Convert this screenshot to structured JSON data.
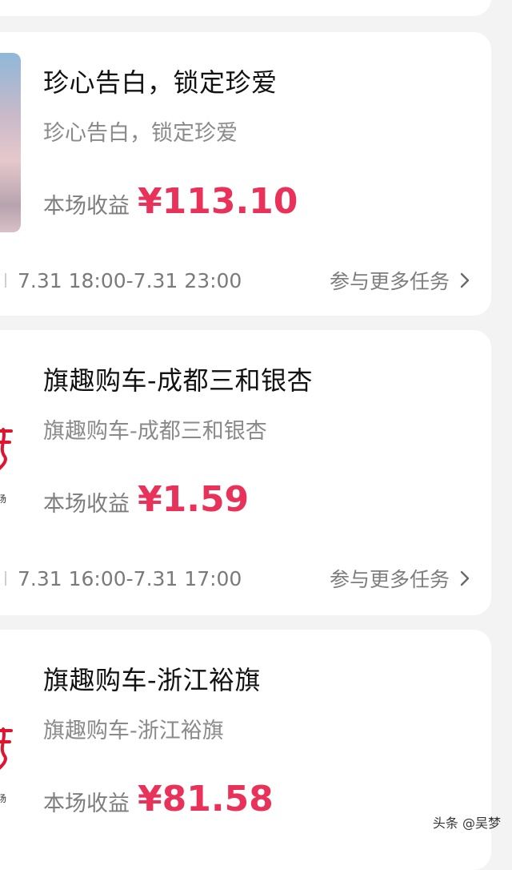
{
  "tasks": [
    {
      "title": "珍心告白，锁定珍爱",
      "subtitle": "珍心告白，锁定珍爱",
      "earnings_label": "本场收益",
      "earnings_value": "¥113.10",
      "time_range": "7.31 18:00-7.31 23:00",
      "more_label": "参与更多任务",
      "thumb_icon": "photo-thumbnail"
    },
    {
      "title": "旗趣购车-成都三和银杏",
      "subtitle": "旗趣购车-成都三和银杏",
      "earnings_label": "本场收益",
      "earnings_value": "¥1.59",
      "time_range": "7.31 16:00-7.31 17:00",
      "more_label": "参与更多任务",
      "thumb_icon": "brand-logo",
      "thumb_sub": "场"
    },
    {
      "title": "旗趣购车-浙江裕旗",
      "subtitle": "旗趣购车-浙江裕旗",
      "earnings_label": "本场收益",
      "earnings_value": "¥81.58",
      "thumb_icon": "brand-logo",
      "thumb_sub": "场"
    }
  ],
  "watermark": "头条 @吴梦",
  "colors": {
    "accent": "#e8325a",
    "background": "#f3f3f3",
    "card": "#ffffff"
  }
}
